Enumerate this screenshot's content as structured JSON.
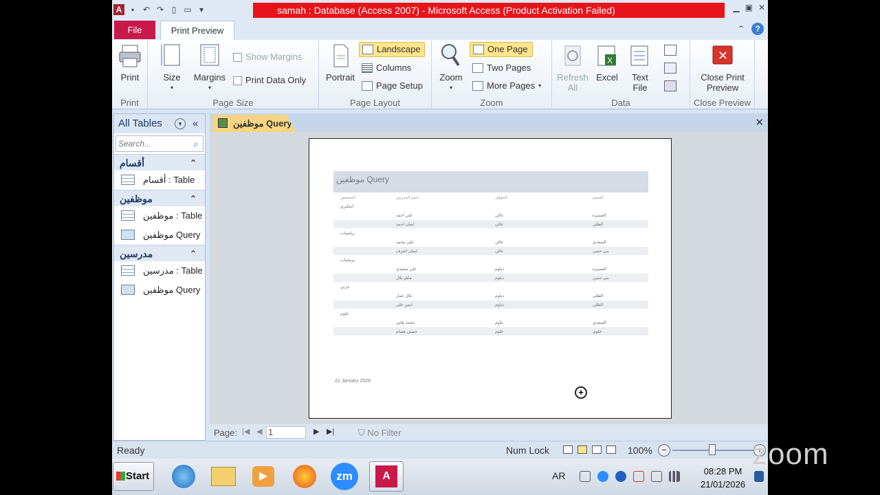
{
  "window": {
    "title": "samah : Database (Access 2007)  -  Microsoft Access (Product Activation Failed)",
    "logo_letter": "A"
  },
  "tabs": {
    "file": "File",
    "print_preview": "Print Preview"
  },
  "ribbon": {
    "print_group": {
      "print": "Print",
      "label": "Print"
    },
    "page_size": {
      "size": "Size",
      "margins": "Margins",
      "show_margins": "Show Margins",
      "print_data_only": "Print Data Only",
      "label": "Page Size"
    },
    "page_layout": {
      "portrait": "Portrait",
      "landscape": "Landscape",
      "columns": "Columns",
      "page_setup": "Page Setup",
      "label": "Page Layout"
    },
    "zoom": {
      "zoom": "Zoom",
      "one_page": "One Page",
      "two_pages": "Two Pages",
      "more_pages": "More Pages",
      "label": "Zoom"
    },
    "data": {
      "refresh_line1": "Refresh",
      "refresh_line2": "All",
      "excel": "Excel",
      "text_line1": "Text",
      "text_line2": "File",
      "label": "Data"
    },
    "close": {
      "line1": "Close Print",
      "line2": "Preview",
      "label": "Close Preview"
    }
  },
  "nav": {
    "header": "All Tables",
    "search_placeholder": "Search...",
    "groups": [
      {
        "name": "أقسام",
        "items": [
          {
            "label": "أقسام : Table",
            "type": "table"
          }
        ]
      },
      {
        "name": "موظفين",
        "items": [
          {
            "label": "موظفين : Table",
            "type": "table"
          },
          {
            "label": "موظفين Query",
            "type": "query"
          }
        ]
      },
      {
        "name": "مدرسين",
        "items": [
          {
            "label": "مدرسين : Table",
            "type": "table"
          },
          {
            "label": "موظفين Query",
            "type": "query"
          }
        ]
      }
    ]
  },
  "document": {
    "tab_label": "موظفين Query",
    "report_title": "موظفين Query",
    "columns": [
      "التخصص",
      "اسم المدرس",
      "المؤهل",
      "القسم"
    ],
    "groups": [
      {
        "name": "انجليزي",
        "rows": [
          [
            "علي احمد",
            "عالي",
            "العسيرة"
          ],
          [
            "ايمان احمد",
            "عالي",
            "الطلي"
          ]
        ]
      },
      {
        "name": "رياضيات",
        "rows": [
          [
            "علي محمد",
            "عالي",
            "السعدي"
          ],
          [
            "ايمان اشرف",
            "عالي",
            "بني حسن"
          ]
        ]
      },
      {
        "name": "برمجيات",
        "rows": [
          [
            "علي سعيدي",
            "دبلوم",
            "العسيرة"
          ],
          [
            "ماهر بلال",
            "دبلوم",
            "بني حسن"
          ]
        ]
      },
      {
        "name": "عربي",
        "rows": [
          [
            "بلال عمار",
            "دبلوم",
            "الطلي"
          ],
          [
            "ايمن علي",
            "دبلوم",
            "الطلي"
          ]
        ]
      },
      {
        "name": "علوم",
        "rows": [
          [
            "محمد هاني",
            "علوم",
            "السعدي"
          ],
          [
            "حسين هشام",
            "علوم",
            "خلوي"
          ]
        ]
      }
    ],
    "date": "21 January 2026"
  },
  "record_nav": {
    "page_label": "Page:",
    "page_value": "1",
    "no_filter": "No Filter"
  },
  "status": {
    "ready": "Ready",
    "num_lock": "Num Lock",
    "zoom_pct": "100%"
  },
  "taskbar": {
    "start": "Start",
    "zm": "zm",
    "lang": "AR",
    "time": "08:28 PM",
    "date": "21/01/2026"
  },
  "watermark": "zoom",
  "colors": {
    "title_red": "#e8141b",
    "file_tab": "#c8194a",
    "selected": "#ffe58c"
  }
}
